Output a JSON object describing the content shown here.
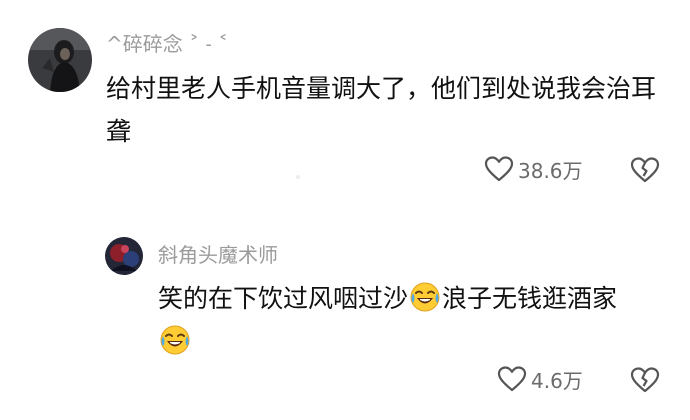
{
  "comments": [
    {
      "username": "^碎碎念 ˃ ˗ ˂",
      "text": "给村里老人手机音量调大了，他们到处说我会治耳聋",
      "likes": "38.6万",
      "avatar_icon": "dark-photo-avatar"
    },
    {
      "username": "斜角头魔术师",
      "text_before": "笑的在下饮过风咽过沙",
      "text_after": "浪子无钱逛酒家",
      "emoji_icon": "rolling-on-floor-laughing-emoji",
      "likes": "4.6万",
      "avatar_icon": "red-blue-photo-avatar"
    }
  ]
}
